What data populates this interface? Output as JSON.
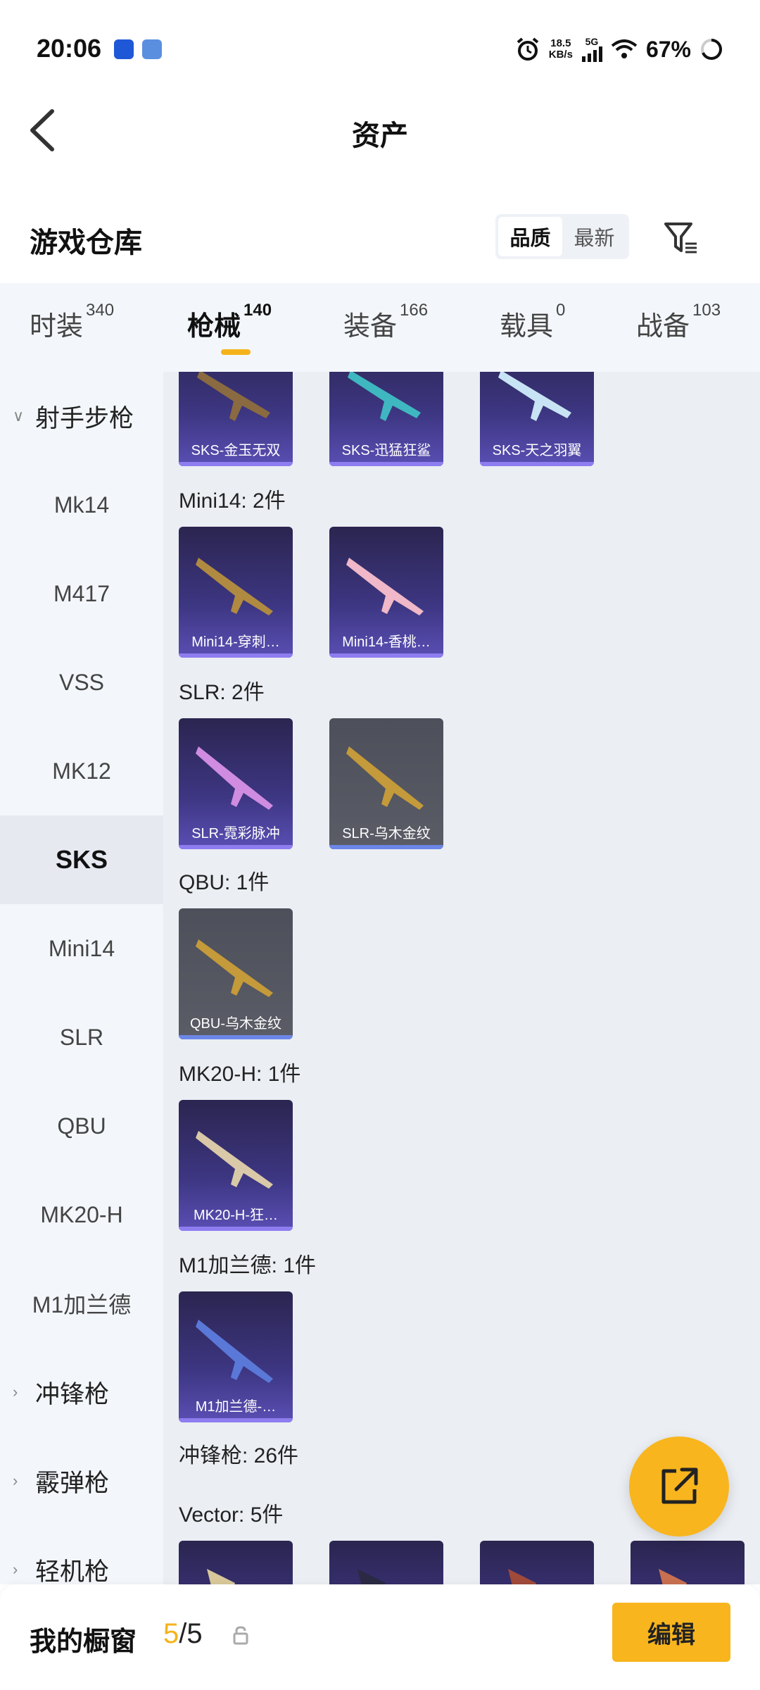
{
  "status": {
    "time": "20:06",
    "speed_top": "18.5",
    "speed_unit": "KB/s",
    "network": "5G",
    "battery": "67%"
  },
  "header": {
    "title": "资产",
    "back_icon": "chevron-left-icon"
  },
  "warehouse": {
    "title": "游戏仓库",
    "sort_options": [
      "品质",
      "最新"
    ],
    "sort_selected": "品质",
    "filter_icon": "filter-icon"
  },
  "tabs": [
    {
      "label": "时装",
      "count": "340"
    },
    {
      "label": "枪械",
      "count": "140"
    },
    {
      "label": "装备",
      "count": "166"
    },
    {
      "label": "载具",
      "count": "0"
    },
    {
      "label": "战备",
      "count": "103"
    }
  ],
  "sidebar": {
    "items": [
      {
        "label": "射手步枪",
        "group": true
      },
      {
        "label": "Mk14"
      },
      {
        "label": "M417"
      },
      {
        "label": "VSS"
      },
      {
        "label": "MK12"
      },
      {
        "label": "SKS",
        "active": true
      },
      {
        "label": "Mini14"
      },
      {
        "label": "SLR"
      },
      {
        "label": "QBU"
      },
      {
        "label": "MK20-H"
      },
      {
        "label": "M1加兰德"
      },
      {
        "label": "冲锋枪",
        "group": true
      },
      {
        "label": "霰弹枪",
        "group": true
      },
      {
        "label": "轻机枪",
        "group": true
      }
    ]
  },
  "content": {
    "sks_items": [
      "SKS-金玉无双",
      "SKS-迅猛狂鲨",
      "SKS-天之羽翼"
    ],
    "groups": [
      {
        "header": "Mini14: 2件",
        "items": [
          "Mini14-穿刺…",
          "Mini14-香桃…"
        ]
      },
      {
        "header": "SLR: 2件",
        "items": [
          "SLR-霓彩脉冲",
          "SLR-乌木金纹"
        ]
      },
      {
        "header": "QBU: 1件",
        "items": [
          "QBU-乌木金纹"
        ]
      },
      {
        "header": "MK20-H: 1件",
        "items": [
          "MK20-H-狂…"
        ]
      },
      {
        "header": "M1加兰德: 1件",
        "items": [
          "M1加兰德-…"
        ]
      }
    ],
    "smg_header": "冲锋枪: 26件",
    "vector_header": "Vector: 5件"
  },
  "bottom": {
    "title": "我的橱窗",
    "current": "5",
    "total": "/5",
    "lock_icon": "lock-icon",
    "edit_label": "编辑"
  },
  "fab_icon": "external-link-icon"
}
